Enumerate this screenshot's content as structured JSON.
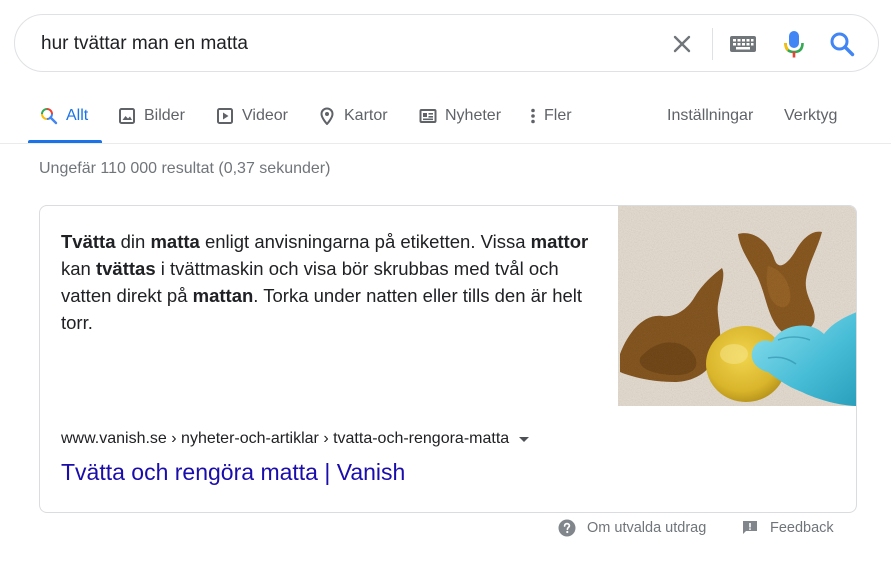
{
  "search": {
    "query": "hur tvättar man en matta",
    "icons": [
      "close-icon",
      "keyboard-icon",
      "microphone-icon",
      "search-icon"
    ]
  },
  "tabs": [
    {
      "label": "Allt",
      "icon": "search-icon",
      "active": true
    },
    {
      "label": "Bilder",
      "icon": "image-icon"
    },
    {
      "label": "Videor",
      "icon": "video-icon"
    },
    {
      "label": "Kartor",
      "icon": "map-pin-icon"
    },
    {
      "label": "Nyheter",
      "icon": "newspaper-icon"
    },
    {
      "label": "Fler",
      "icon": "more-vert-icon"
    }
  ],
  "tools": {
    "settings": "Inställningar",
    "tools": "Verktyg"
  },
  "result_stats": "Ungefär 110 000 resultat (0,37 sekunder)",
  "featured_snippet": {
    "text_segments": [
      {
        "text": "Tvätta",
        "bold": true
      },
      {
        "text": " din ",
        "bold": false
      },
      {
        "text": "matta",
        "bold": true
      },
      {
        "text": " enligt anvisningarna på etiketten. Vissa ",
        "bold": false
      },
      {
        "text": "mattor",
        "bold": true
      },
      {
        "text": " kan ",
        "bold": false
      },
      {
        "text": "tvättas",
        "bold": true
      },
      {
        "text": " i tvättmaskin och visa bör skrubbas med tvål och vatten direkt på ",
        "bold": false
      },
      {
        "text": "mattan",
        "bold": true
      },
      {
        "text": ". Torka under natten eller tills den är helt torr.",
        "bold": false
      }
    ],
    "cite": "www.vanish.se › nyheter-och-artiklar › tvatta-och-rengora-matta",
    "title": "Tvätta och rengöra matta | Vanish"
  },
  "footer": {
    "about": "Om utvalda utdrag",
    "feedback": "Feedback"
  },
  "colors": {
    "accent": "#1a73e8",
    "link": "#1a0dab",
    "muted": "#70757a",
    "text": "#202124"
  }
}
